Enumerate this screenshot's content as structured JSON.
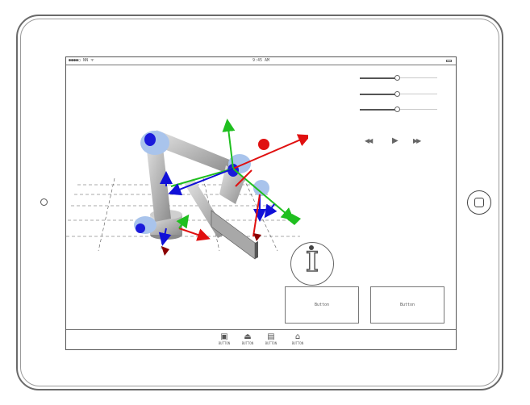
{
  "status_bar": {
    "carrier": "●●●●○ NN ᯤ",
    "time": "9:45 AM"
  },
  "sliders": [
    {
      "name": "slider-1",
      "value": 0.48
    },
    {
      "name": "slider-2",
      "value": 0.48
    },
    {
      "name": "slider-3",
      "value": 0.48
    }
  ],
  "media_controls": {
    "rewind_icon": "◀◀",
    "play_icon": "▶",
    "forward_icon": "▶▶"
  },
  "info": {
    "glyph": "I"
  },
  "buttons": {
    "left_label": "Button",
    "right_label": "Button"
  },
  "toolbar": {
    "items": [
      {
        "icon": "camera-icon",
        "glyph": "▣",
        "label": "BUTTON"
      },
      {
        "icon": "robot-icon",
        "glyph": "⏏",
        "label": "BUTTON"
      },
      {
        "icon": "document-icon",
        "glyph": "▤",
        "label": "BUTTON"
      },
      {
        "icon": "home-icon",
        "glyph": "⌂",
        "label": "BUTTON"
      }
    ]
  },
  "colors": {
    "axis_red": "#e01010",
    "axis_green": "#1fbf1f",
    "axis_blue": "#1010d8",
    "joint_cap": "#a9c4ec",
    "robot_body": "#bdbdbd"
  }
}
